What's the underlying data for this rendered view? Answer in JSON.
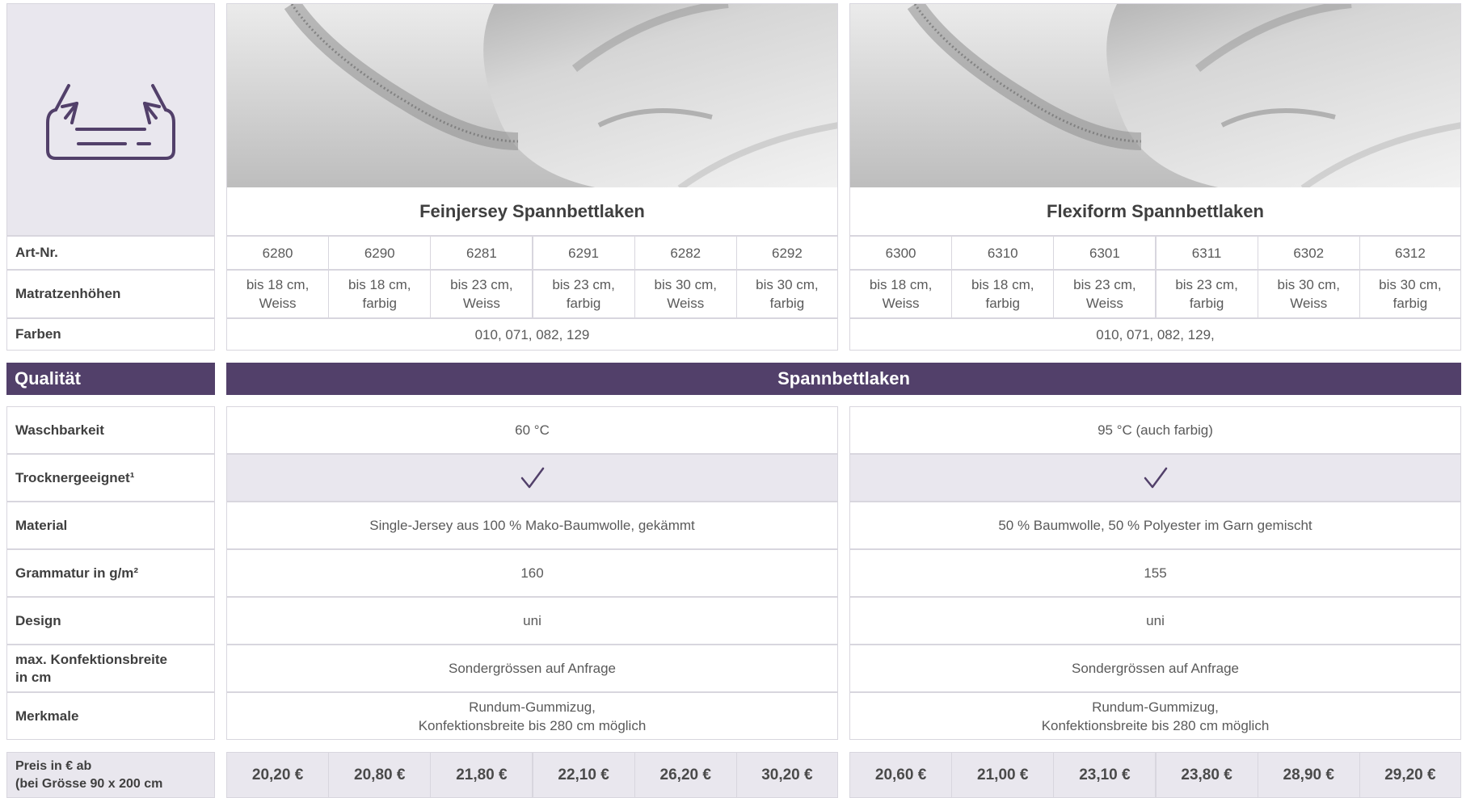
{
  "labels": {
    "art_nr": "Art-Nr.",
    "matratzenhoehen": "Matratzenhöhen",
    "farben": "Farben",
    "qualitaet": "Qualität",
    "waschbarkeit": "Waschbarkeit",
    "trocknergeeignet": "Trocknergeeignet¹",
    "material": "Material",
    "grammatur": "Grammatur in g/m²",
    "design": "Design",
    "konfektionsbreite_line1": "max. Konfektionsbreite",
    "konfektionsbreite_line2": "in cm",
    "merkmale": "Merkmale",
    "preis_line1": "Preis in € ab",
    "preis_line2": "(bei Grösse 90 x 200 cm"
  },
  "section_title": "Spannbettlaken",
  "icon": "fitted-mattress-icon",
  "accent_color": "#52406a",
  "products": [
    {
      "name": "Feinjersey Spannbettlaken",
      "articles": [
        "6280",
        "6290",
        "6281",
        "6291",
        "6282",
        "6292"
      ],
      "heights": [
        [
          "bis 18 cm,",
          "Weiss"
        ],
        [
          "bis 18 cm,",
          "farbig"
        ],
        [
          "bis 23 cm,",
          "Weiss"
        ],
        [
          "bis 23 cm,",
          "farbig"
        ],
        [
          "bis 30 cm,",
          "Weiss"
        ],
        [
          "bis 30 cm,",
          "farbig"
        ]
      ],
      "farben": "010, 071, 082, 129",
      "waschbarkeit": "60 °C",
      "trocknergeeignet": true,
      "material": "Single-Jersey aus 100 % Mako-Baumwolle, gekämmt",
      "grammatur": "160",
      "design": "uni",
      "konfektionsbreite": "Sondergrössen auf Anfrage",
      "merkmale_line1": "Rundum-Gummizug,",
      "merkmale_line2": "Konfektionsbreite bis 280 cm möglich",
      "prices": [
        "20,20 €",
        "20,80 €",
        "21,80 €",
        "22,10 €",
        "26,20 €",
        "30,20 €"
      ]
    },
    {
      "name": "Flexiform Spannbettlaken",
      "articles": [
        "6300",
        "6310",
        "6301",
        "6311",
        "6302",
        "6312"
      ],
      "heights": [
        [
          "bis 18 cm,",
          "Weiss"
        ],
        [
          "bis 18 cm,",
          "farbig"
        ],
        [
          "bis 23 cm,",
          "Weiss"
        ],
        [
          "bis 23 cm,",
          "farbig"
        ],
        [
          "bis 30 cm,",
          "Weiss"
        ],
        [
          "bis 30 cm,",
          "farbig"
        ]
      ],
      "farben": "010, 071, 082, 129,",
      "waschbarkeit": "95 °C (auch farbig)",
      "trocknergeeignet": true,
      "material": "50 % Baumwolle, 50 % Polyester im Garn gemischt",
      "grammatur": "155",
      "design": "uni",
      "konfektionsbreite": "Sondergrössen auf Anfrage",
      "merkmale_line1": "Rundum-Gummizug,",
      "merkmale_line2": "Konfektionsbreite bis 280 cm möglich",
      "prices": [
        "20,60 €",
        "21,00 €",
        "23,10 €",
        "23,80 €",
        "28,90 €",
        "29,20 €"
      ]
    }
  ]
}
